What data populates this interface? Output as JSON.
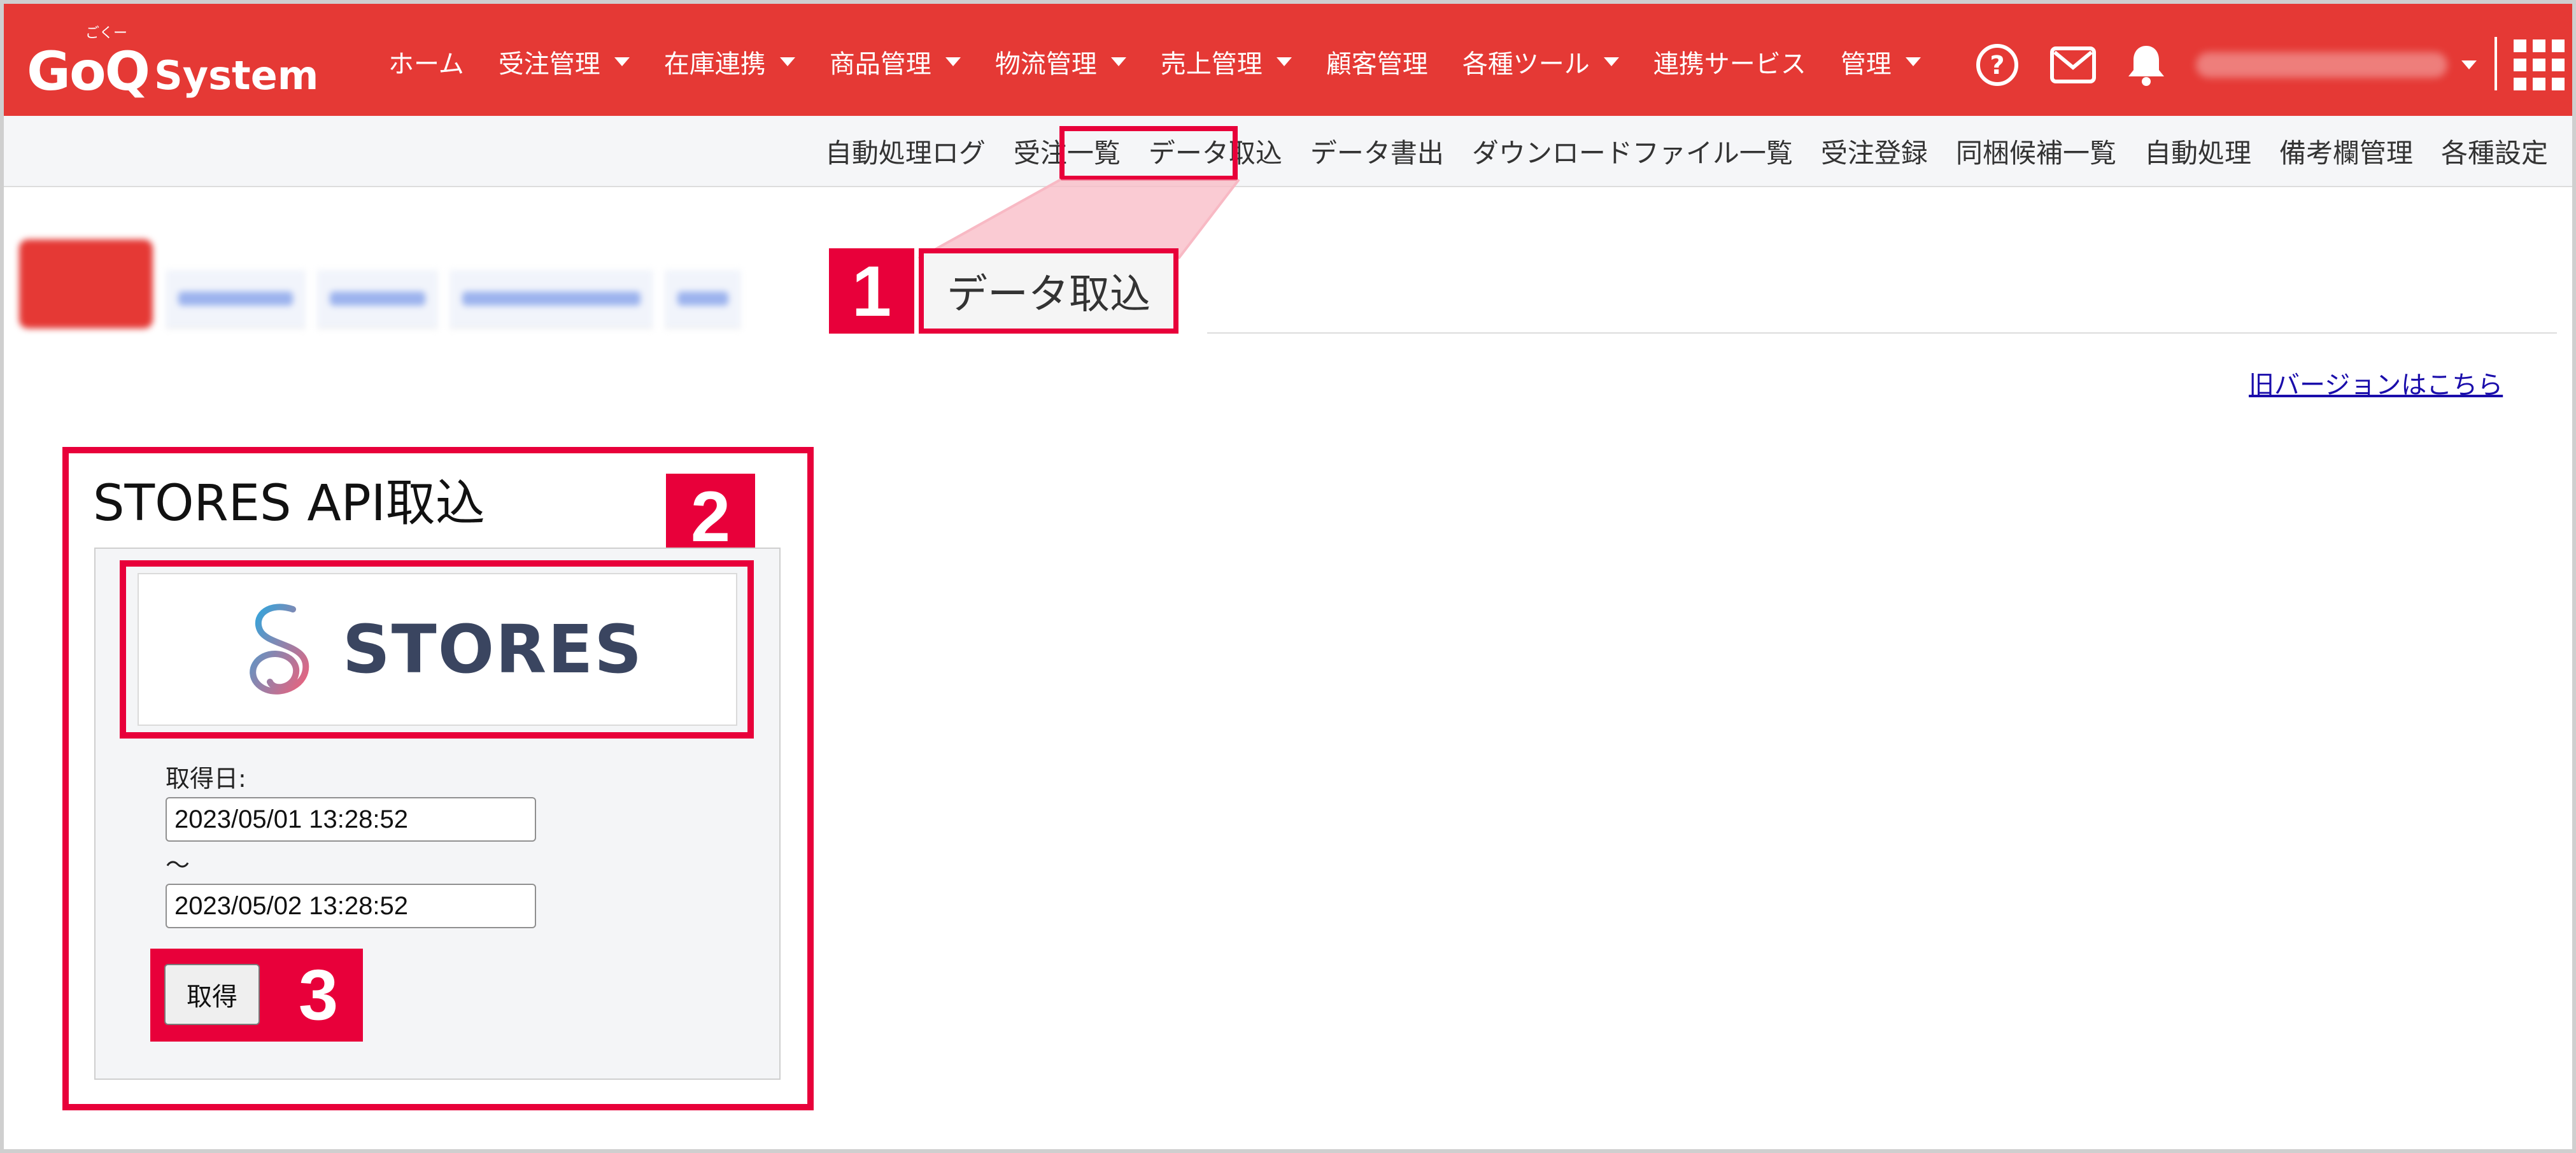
{
  "app": {
    "logo_text": "GoQ",
    "logo_sub": "System",
    "logo_ruby": "ごくー"
  },
  "nav": {
    "items": [
      {
        "label": "ホーム",
        "dropdown": false
      },
      {
        "label": "受注管理",
        "dropdown": true
      },
      {
        "label": "在庫連携",
        "dropdown": true
      },
      {
        "label": "商品管理",
        "dropdown": true
      },
      {
        "label": "物流管理",
        "dropdown": true
      },
      {
        "label": "売上管理",
        "dropdown": true
      },
      {
        "label": "顧客管理",
        "dropdown": false
      },
      {
        "label": "各種ツール",
        "dropdown": true
      },
      {
        "label": "連携サービス",
        "dropdown": false
      },
      {
        "label": "管理",
        "dropdown": true
      }
    ],
    "icons": [
      "help-icon",
      "mail-icon",
      "bell-icon",
      "apps-grid-icon"
    ]
  },
  "subnav": {
    "items": [
      "自動処理ログ",
      "受注一覧",
      "データ取込",
      "データ書出",
      "ダウンロードファイル一覧",
      "受注登録",
      "同梱候補一覧",
      "自動処理",
      "備考欄管理",
      "各種設定"
    ],
    "active": "データ取込"
  },
  "callouts": {
    "step1": "1",
    "step2": "2",
    "step3": "3",
    "tab_label": "データ取込"
  },
  "links": {
    "old_version": "旧バージョンはこちら"
  },
  "section": {
    "title": "STORES API取込",
    "brand": "STORES",
    "date_label": "取得日:",
    "date_from": "2023/05/01 13:28:52",
    "range_sep": "～",
    "date_to": "2023/05/02 13:28:52",
    "get_button": "取得"
  },
  "colors": {
    "brand_red": "#e53935",
    "callout_red": "#e8003a",
    "link": "#1a0dab"
  }
}
